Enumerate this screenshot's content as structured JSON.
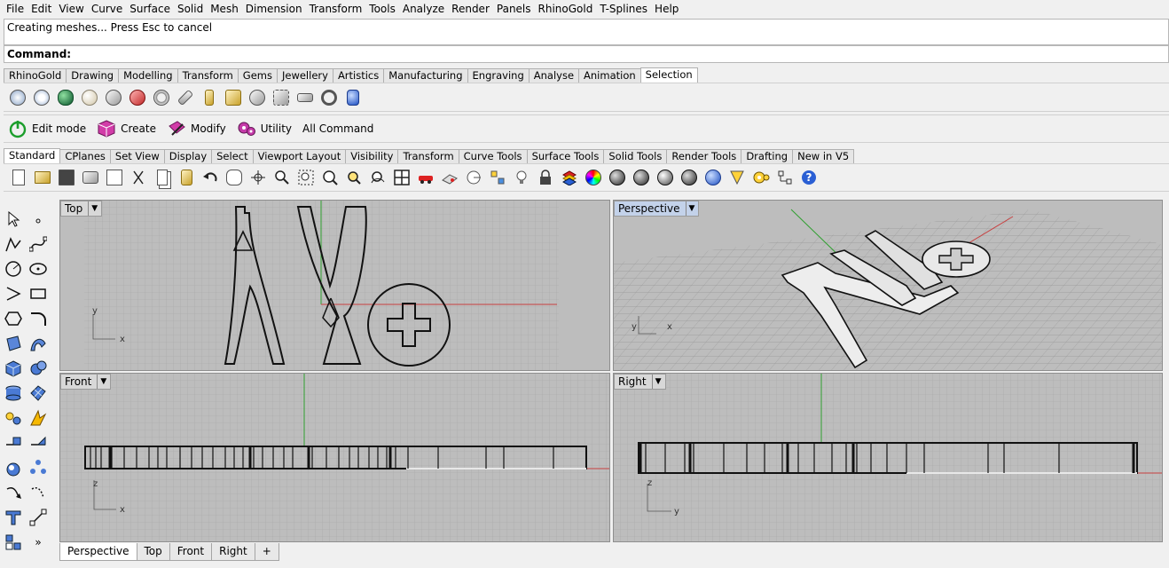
{
  "menu": [
    "File",
    "Edit",
    "View",
    "Curve",
    "Surface",
    "Solid",
    "Mesh",
    "Dimension",
    "Transform",
    "Tools",
    "Analyze",
    "Render",
    "Panels",
    "RhinoGold",
    "T-Splines",
    "Help"
  ],
  "status_text": "Creating meshes... Press Esc to cancel",
  "command_label": "Command:",
  "rhinogold_tabs": [
    "RhinoGold",
    "Drawing",
    "Modelling",
    "Transform",
    "Gems",
    "Jewellery",
    "Artistics",
    "Manufacturing",
    "Engraving",
    "Analyse",
    "Animation",
    "Selection"
  ],
  "rhinogold_active_tab": "Selection",
  "selection_icons": [
    "diamond-icon",
    "gem-cluster-icon",
    "emerald-icon",
    "pearl-icon",
    "sphere-select-icon",
    "label-icon",
    "ring-icon",
    "pen-icon",
    "pin-icon",
    "bezel-icon",
    "shank-icon",
    "chain-icon",
    "bar-icon",
    "bracelet-icon",
    "cylinder-icon"
  ],
  "cmd_buttons": [
    {
      "label": "Edit mode",
      "icon": "power-icon"
    },
    {
      "label": "Create",
      "icon": "cube-icon"
    },
    {
      "label": "Modify",
      "icon": "modify-icon"
    },
    {
      "label": "Utility",
      "icon": "gears-icon"
    },
    {
      "label": "All Command",
      "icon": ""
    }
  ],
  "std_tabs": [
    "Standard",
    "CPlanes",
    "Set View",
    "Display",
    "Select",
    "Viewport Layout",
    "Visibility",
    "Transform",
    "Curve Tools",
    "Surface Tools",
    "Solid Tools",
    "Render Tools",
    "Drafting",
    "New in V5"
  ],
  "std_active_tab": "Standard",
  "std_icons": [
    "new-icon",
    "open-icon",
    "save-icon",
    "print-icon",
    "import-icon",
    "cut-icon",
    "copy-icon",
    "paste-icon",
    "undo-icon",
    "pan-hand-icon",
    "rotate-view-icon",
    "zoom-icon",
    "zoom-window-icon",
    "zoom-extents-icon",
    "zoom-selected-icon",
    "rotate-icon",
    "four-viewports-icon",
    "car-icon",
    "camera-icon",
    "target-icon",
    "points-icon",
    "light-bulb-icon",
    "lock-icon",
    "layer-icon",
    "color-wheel-icon",
    "wireframe-sphere-icon",
    "shaded-sphere-icon",
    "rendered-sphere-icon",
    "ghosted-sphere-icon",
    "blue-sphere-icon",
    "osnap-icon",
    "settings-icon",
    "options-icon",
    "help-icon"
  ],
  "left_tools": [
    "select-arrow-icon",
    "point-icon",
    "polyline-icon",
    "curve-icon",
    "circle-icon",
    "ellipse-icon",
    "arc-icon",
    "rectangle-icon",
    "polygon-icon",
    "fillet-icon",
    "surface-icon",
    "sweep-icon",
    "box-icon",
    "sphere-icon",
    "cylinder-icon",
    "mesh-icon",
    "explode-icon",
    "boolean-icon",
    "split-icon",
    "trim-icon",
    "group-icon",
    "array-icon",
    "move-icon",
    "scale-icon",
    "text-icon",
    "transform-icon",
    "grid-icon",
    "more-icon"
  ],
  "viewports": {
    "top": {
      "label": "Top",
      "axis_a": "y",
      "axis_b": "x"
    },
    "perspective": {
      "label": "Perspective",
      "axis_a": "y",
      "axis_b": "x"
    },
    "front": {
      "label": "Front",
      "axis_a": "z",
      "axis_b": "x"
    },
    "right": {
      "label": "Right",
      "axis_a": "z",
      "axis_b": "y"
    }
  },
  "more_label": "»",
  "bottom_tabs": [
    "Perspective",
    "Top",
    "Front",
    "Right"
  ],
  "bottom_active_tab": "Perspective",
  "add_tab_label": "+"
}
